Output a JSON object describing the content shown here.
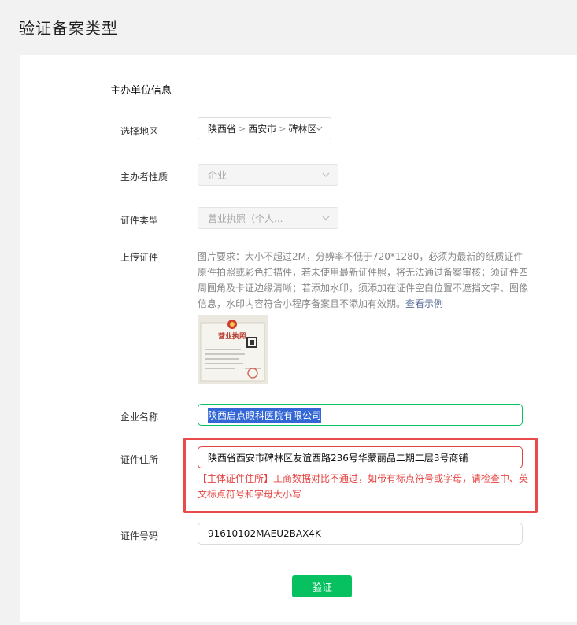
{
  "page": {
    "title": "验证备案类型"
  },
  "section": {
    "title": "主办单位信息"
  },
  "region": {
    "label": "选择地区",
    "province": "陕西省",
    "city": "西安市",
    "district": "碑林区",
    "separator": ">"
  },
  "host_type": {
    "label": "主办者性质",
    "value": "企业"
  },
  "cert_type": {
    "label": "证件类型",
    "value": "营业执照（个人..."
  },
  "upload": {
    "label": "上传证件",
    "note": "图片要求：大小不超过2M，分辨率不低于720*1280，必须为最新的纸质证件原件拍照或彩色扫描件，若未使用最新证件照，将无法通过备案审核；须证件四周圆角及卡证边缘清晰；若添加水印，须添加在证件空白位置不遮挡文字、图像信息，水印内容符合小程序备案且不添加有效期。",
    "link": "查看示例",
    "thumb_title": "营业执照"
  },
  "company": {
    "label": "企业名称",
    "value": "陕西启点眼科医院有限公司"
  },
  "address": {
    "label": "证件住所",
    "value": "陕西省西安市碑林区友谊西路236号华蒙丽晶二期二层3号商铺",
    "error": "【主体证件住所】工商数据对比不通过，如带有标点符号或字母，请检查中、英文标点符号和字母大小写"
  },
  "cert_no": {
    "label": "证件号码",
    "value": "91610102MAEU2BAX4K"
  },
  "submit": {
    "label": "验证"
  },
  "colors": {
    "accent": "#07c160",
    "error": "#e64340",
    "link": "#576b95"
  }
}
